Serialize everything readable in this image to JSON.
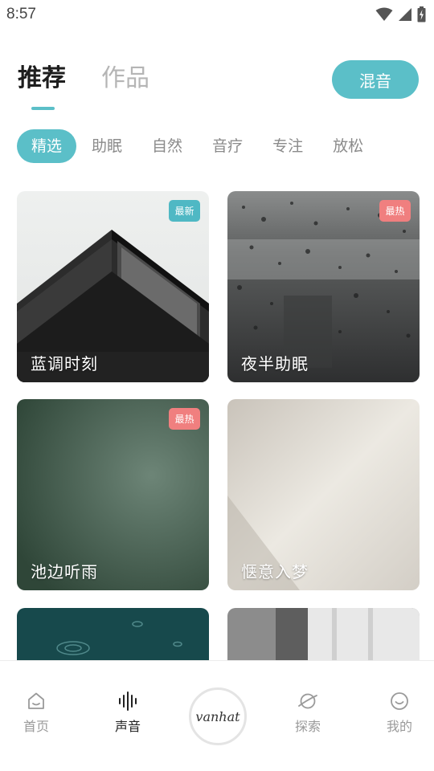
{
  "status_bar": {
    "time": "8:57"
  },
  "header": {
    "tabs": [
      {
        "label": "推荐"
      },
      {
        "label": "作品"
      }
    ],
    "mix_button": "混音",
    "accent_color": "#5bbfc8"
  },
  "categories": [
    {
      "label": "精选"
    },
    {
      "label": "助眠"
    },
    {
      "label": "自然"
    },
    {
      "label": "音疗"
    },
    {
      "label": "专注"
    },
    {
      "label": "放松"
    }
  ],
  "cards": [
    {
      "title": "蓝调时刻",
      "badge": "最新",
      "badge_type": "new"
    },
    {
      "title": "夜半助眠",
      "badge": "最热",
      "badge_type": "hot"
    },
    {
      "title": "池边听雨",
      "badge": "最热",
      "badge_type": "hot"
    },
    {
      "title": "惬意入梦",
      "badge": "",
      "badge_type": ""
    },
    {
      "title": "",
      "badge": "",
      "badge_type": ""
    },
    {
      "title": "",
      "badge": "",
      "badge_type": ""
    }
  ],
  "bottom_nav": {
    "items": [
      {
        "label": "首页",
        "icon": "home-icon"
      },
      {
        "label": "声音",
        "icon": "waveform-icon"
      },
      {
        "label": "探索",
        "icon": "planet-icon"
      },
      {
        "label": "我的",
        "icon": "smiley-icon"
      }
    ],
    "center_logo": "vanhat"
  }
}
